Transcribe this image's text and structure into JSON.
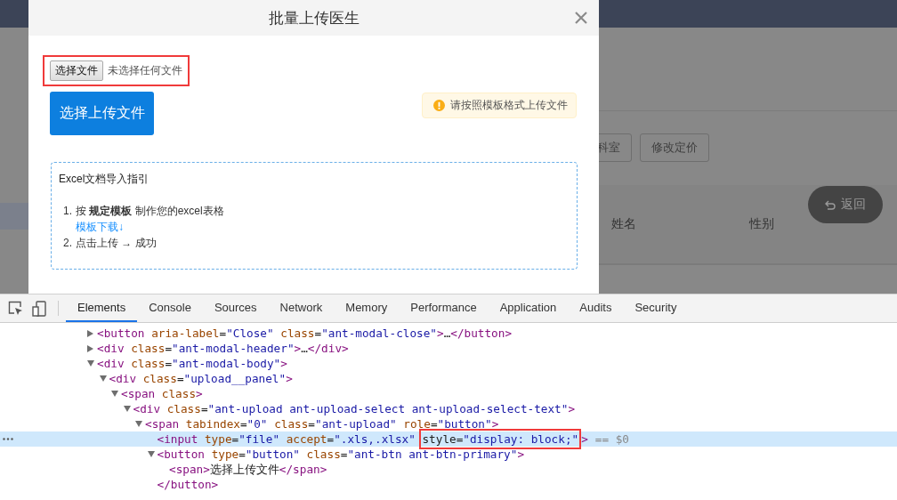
{
  "background": {
    "sidebar": {
      "selected_item": {
        "selected": true
      }
    },
    "toolbar_buttons": [
      "科室",
      "修改定价"
    ],
    "table_columns": [
      "姓名",
      "性别"
    ],
    "back_button": {
      "label": "返回"
    }
  },
  "modal": {
    "title": "批量上传医生",
    "file_input": {
      "button": "选择文件",
      "status": "未选择任何文件",
      "highlighted": true
    },
    "upload_button": "选择上传文件",
    "notice": "请按照模板格式上传文件",
    "guide": {
      "title": "Excel文档导入指引",
      "steps": [
        {
          "number": "1.",
          "text": "按 **规定模板** 制作您的excel表格",
          "link": "模板下载↓"
        },
        {
          "number": "2.",
          "text": "点击上传 → 成功"
        }
      ]
    }
  },
  "devtools": {
    "tabs": [
      {
        "label": "Elements",
        "selected": true
      },
      {
        "label": "Console",
        "selected": false
      },
      {
        "label": "Sources",
        "selected": false
      },
      {
        "label": "Network",
        "selected": false
      },
      {
        "label": "Memory",
        "selected": false
      },
      {
        "label": "Performance",
        "selected": false
      },
      {
        "label": "Application",
        "selected": false
      },
      {
        "label": "Audits",
        "selected": false
      },
      {
        "label": "Security",
        "selected": false
      }
    ],
    "nodes": [
      {
        "text": "<button aria-label=\"Close\" class=\"ant-modal-close\">…</button>",
        "expanded": false,
        "selected": false
      },
      {
        "text": "<div class=\"ant-modal-header\">…</div>",
        "expanded": false,
        "selected": false
      },
      {
        "text": "<div class=\"ant-modal-body\">",
        "expanded": true,
        "selected": false,
        "children": [
          {
            "text": "<div class=\"upload__panel\">",
            "expanded": true,
            "selected": false,
            "children": [
              {
                "text": "<span class>",
                "expanded": true,
                "selected": false,
                "children": [
                  {
                    "text": "<div class=\"ant-upload ant-upload-select ant-upload-select-text\">",
                    "expanded": true,
                    "selected": false,
                    "children": [
                      {
                        "text": "<span tabindex=\"0\" class=\"ant-upload\" role=\"button\">",
                        "expanded": true,
                        "selected": false,
                        "children": [
                          {
                            "text": "<input type=\"file\" accept=\".xls,.xlsx\" ",
                            "boxed": "style=\"display: block;\"",
                            "tail": ">",
                            "ref": "== $0",
                            "selected": true
                          },
                          {
                            "text": "<button type=\"button\" class=\"ant-btn ant-btn-primary\">",
                            "expanded": true,
                            "selected": false,
                            "closing": "</button>",
                            "children": [
                              {
                                "text": "<span>选择上传文件</span>",
                                "selected": false
                              }
                            ]
                          }
                        ]
                      }
                    ]
                  }
                ]
              }
            ]
          }
        ]
      }
    ]
  }
}
